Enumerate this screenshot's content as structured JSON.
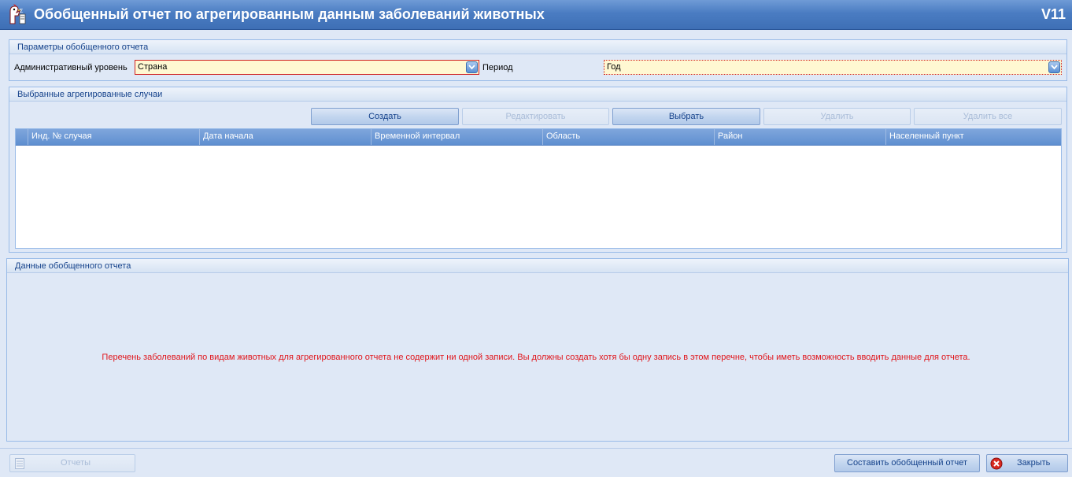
{
  "window": {
    "title": "Обобщенный отчет по агрегированным данным заболеваний животных",
    "version": "V11"
  },
  "params": {
    "header": "Параметры обобщенного отчета",
    "admin_level_label": "Административный уровень",
    "admin_level_value": "Страна",
    "period_label": "Период",
    "period_value": "Год"
  },
  "cases": {
    "header": "Выбранные агрегированные случаи",
    "buttons": {
      "create": "Создать",
      "edit": "Редактировать",
      "select": "Выбрать",
      "delete": "Удалить",
      "delete_all": "Удалить все"
    },
    "columns": [
      "Инд. № случая",
      "Дата начала",
      "Временной интервал",
      "Область",
      "Район",
      "Населенный пункт"
    ]
  },
  "report_data": {
    "header": "Данные обобщенного отчета",
    "message": "Перечень заболеваний по видам животных для агрегированного отчета не содержит ни одной записи. Вы должны создать хотя бы одну запись в этом перечне, чтобы иметь возможность вводить данные для отчета."
  },
  "footer": {
    "reports": "Отчеты",
    "compose": "Составить обобщенный отчет",
    "close": "Закрыть"
  },
  "colors": {
    "required_border": "#d02020",
    "required_fill": "#fff8d2",
    "message": "#e0151b"
  }
}
